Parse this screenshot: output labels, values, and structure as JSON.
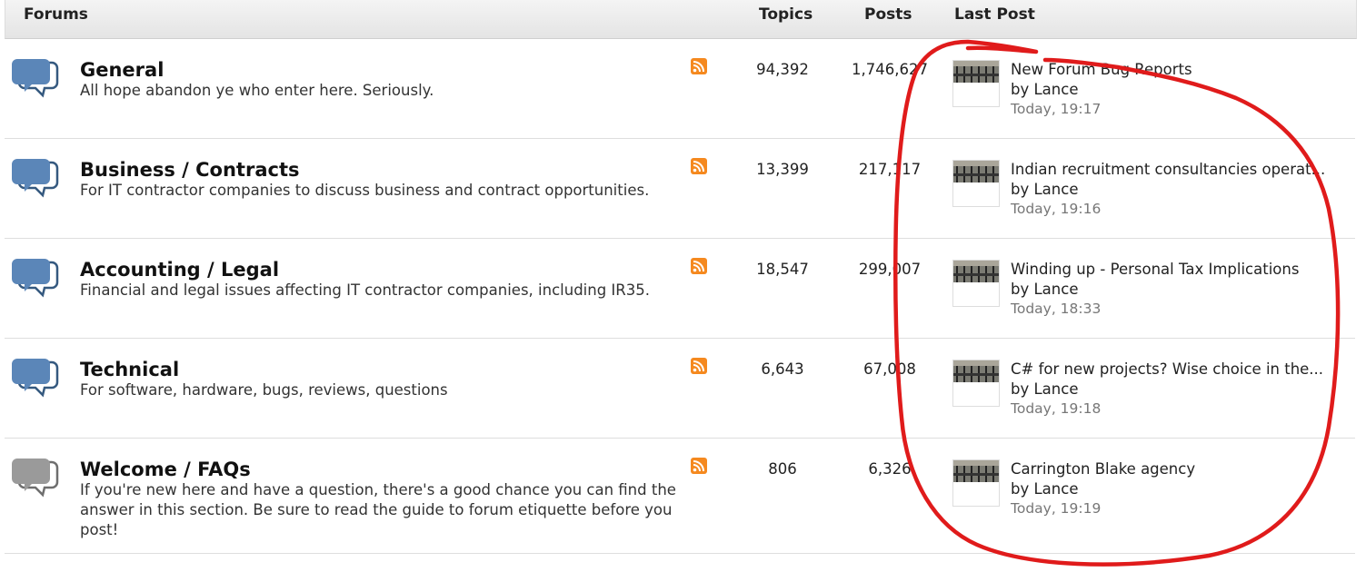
{
  "header": {
    "forums": "Forums",
    "topics": "Topics",
    "posts": "Posts",
    "last_post": "Last Post"
  },
  "forums": [
    {
      "title": "General",
      "description": "All hope abandon ye who enter here. Seriously.",
      "topics": "94,392",
      "posts": "1,746,627",
      "last_post": {
        "title": "New Forum Bug Reports",
        "by": "by Lance",
        "date": "Today, 19:17"
      },
      "icon": "speech-bubble-blue-icon"
    },
    {
      "title": "Business / Contracts",
      "description": "For IT contractor companies to discuss business and contract opportunities.",
      "topics": "13,399",
      "posts": "217,117",
      "last_post": {
        "title": "Indian recruitment consultancies operat...",
        "by": "by Lance",
        "date": "Today, 19:16"
      },
      "icon": "speech-bubble-blue-icon"
    },
    {
      "title": "Accounting / Legal",
      "description": "Financial and legal issues affecting IT contractor companies, including IR35.",
      "topics": "18,547",
      "posts": "299,007",
      "last_post": {
        "title": "Winding up - Personal Tax Implications",
        "by": "by Lance",
        "date": "Today, 18:33"
      },
      "icon": "speech-bubble-blue-icon"
    },
    {
      "title": "Technical",
      "description": "For software, hardware, bugs, reviews, questions",
      "topics": "6,643",
      "posts": "67,008",
      "last_post": {
        "title": "C# for new projects? Wise choice in the...",
        "by": "by Lance",
        "date": "Today, 19:18"
      },
      "icon": "speech-bubble-blue-icon"
    },
    {
      "title": "Welcome / FAQs",
      "description": "If you're new here and have a question, there's a good chance you can find the answer in this section. Be sure to read the guide to forum etiquette before you post!",
      "topics": "806",
      "posts": "6,326",
      "last_post": {
        "title": "Carrington Blake agency",
        "by": "by Lance",
        "date": "Today, 19:19"
      },
      "icon": "speech-bubble-gray-icon"
    }
  ],
  "colors": {
    "bubble_blue": "#5b86b8",
    "bubble_gray": "#9a9a9a",
    "rss_orange": "#f5891f",
    "annotation_red": "#e01b1b"
  }
}
